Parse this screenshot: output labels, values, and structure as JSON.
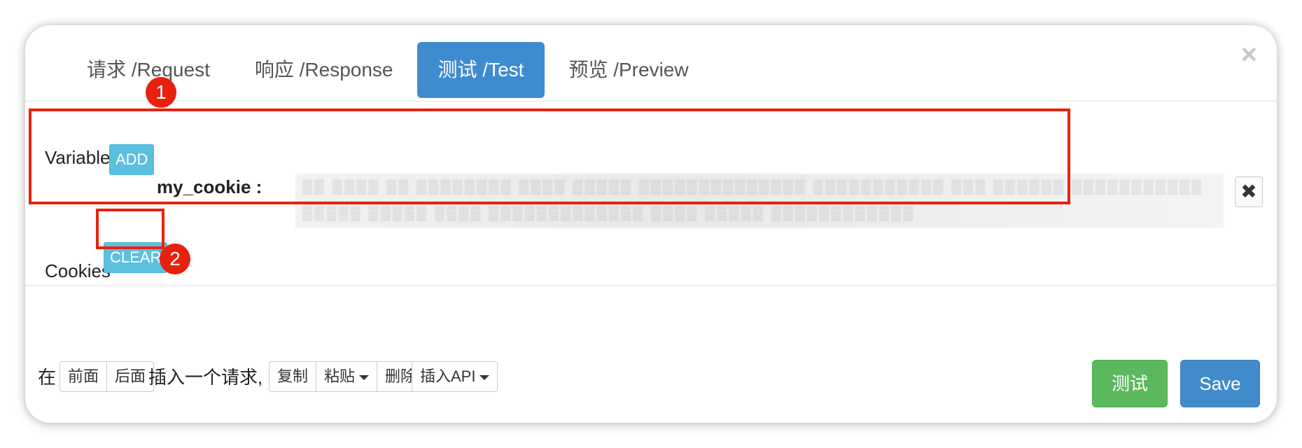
{
  "tabs": [
    {
      "label": "请求 /Request",
      "active": false
    },
    {
      "label": "响应 /Response",
      "active": false
    },
    {
      "label": "测试 /Test",
      "active": true
    },
    {
      "label": "预览 /Preview",
      "active": false
    }
  ],
  "close_icon": "×",
  "variables": {
    "label": "Variables",
    "add_label": "ADD",
    "items": [
      {
        "name": "my_cookie :",
        "value_redacted": true
      }
    ],
    "remove_icon": "✖"
  },
  "cookies": {
    "label": "Cookies",
    "clear_label": "CLEAR"
  },
  "annotations": {
    "marker_1": "1",
    "marker_2": "2",
    "color": "#e8210e"
  },
  "footer": {
    "prefix": "在",
    "before_label": "前面",
    "after_label": "后面",
    "insert_text": "插入一个请求,",
    "copy_label": "复制",
    "paste_label": "粘贴",
    "delete_label": "删除",
    "insert_api_label": "插入API",
    "test_label": "测试",
    "save_label": "Save"
  },
  "colors": {
    "tab_active": "#3f8bd0",
    "info_button": "#5bc0de",
    "success_button": "#5cb85c",
    "primary_button": "#428bca"
  }
}
